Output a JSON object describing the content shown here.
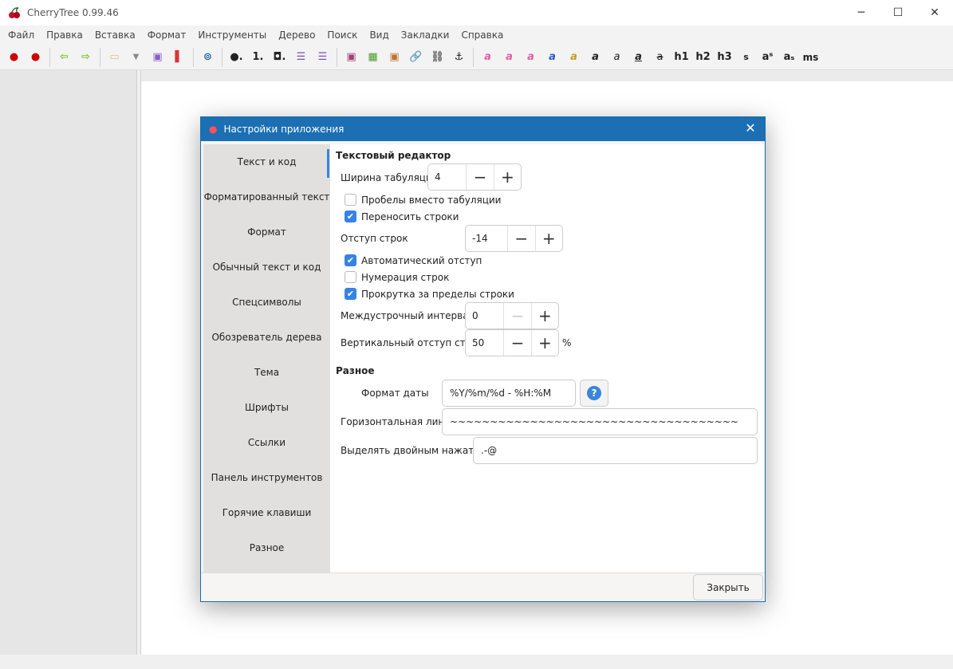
{
  "app": {
    "title": "CherryTree 0.99.46"
  },
  "menu": [
    "Файл",
    "Правка",
    "Вставка",
    "Формат",
    "Инструменты",
    "Дерево",
    "Поиск",
    "Вид",
    "Закладки",
    "Справка"
  ],
  "toolbar": {
    "text_buttons": [
      "h1",
      "h2",
      "h3",
      "s",
      "aˢ",
      "aₛ",
      "ms"
    ]
  },
  "dialog": {
    "title": "Настройки приложения",
    "sidebar": [
      "Текст и код",
      "Форматированный текст",
      "Формат",
      "Обычный текст и код",
      "Спецсимволы",
      "Обозреватель дерева",
      "Тема",
      "Шрифты",
      "Ссылки",
      "Панель инструментов",
      "Горячие клавиши",
      "Разное"
    ],
    "selected_index": 0,
    "section1": "Текстовый редактор",
    "tab_width": {
      "label": "Ширина табуляции",
      "value": "4"
    },
    "spaces_instead_tabs": {
      "label": "Пробелы вместо табуляции",
      "checked": false
    },
    "wrap_lines": {
      "label": "Переносить строки",
      "checked": true
    },
    "line_indent": {
      "label": "Отступ строк",
      "value": "-14"
    },
    "auto_indent": {
      "label": "Автоматический отступ",
      "checked": true
    },
    "line_numbers": {
      "label": "Нумерация строк",
      "checked": false
    },
    "scroll_beyond": {
      "label": "Прокрутка за пределы строки",
      "checked": true
    },
    "line_spacing": {
      "label": "Междустрочный интервал",
      "value": "0"
    },
    "vertical_indent": {
      "label": "Вертикальный отступ строк",
      "value": "50",
      "unit": "%"
    },
    "section2": "Разное",
    "date_format": {
      "label": "Формат даты",
      "value": "%Y/%m/%d - %H:%M"
    },
    "horizontal_line": {
      "label": "Горизонтальная линия",
      "value": "~~~~~~~~~~~~~~~~~~~~~~~~~~~~~~~~~~~~"
    },
    "double_click": {
      "label": "Выделять двойным нажатием",
      "value": ".-@"
    },
    "close_label": "Закрыть"
  },
  "colors": {
    "accent": "#3584e4",
    "dialog_header": "#1b6fb2"
  }
}
